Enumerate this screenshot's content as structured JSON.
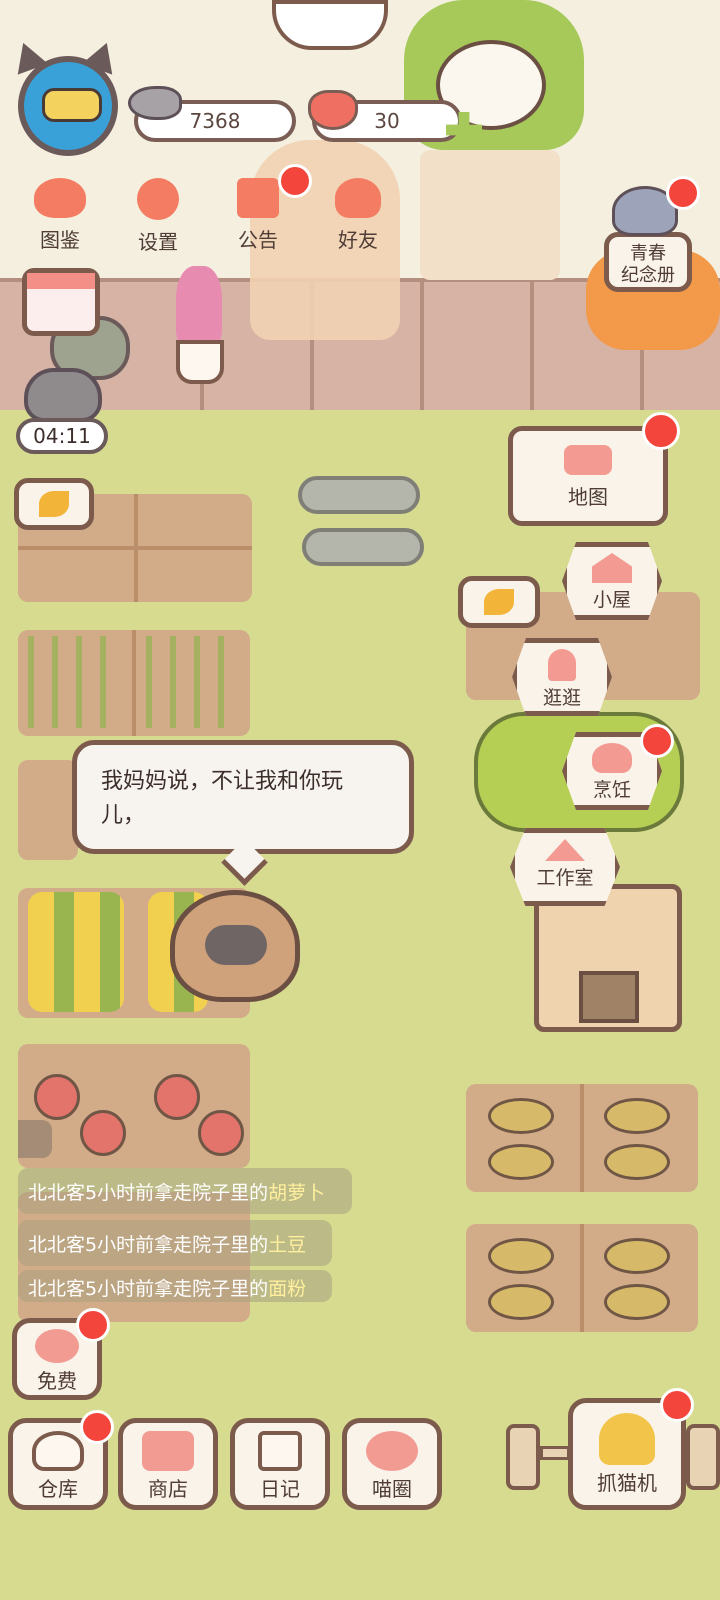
{
  "hud": {
    "fish_count": "7368",
    "heart_count": "30",
    "timer": "04:11"
  },
  "top_menu": [
    {
      "label": "图鉴",
      "icon": "cat-head-icon"
    },
    {
      "label": "设置",
      "icon": "gear-icon"
    },
    {
      "label": "公告",
      "icon": "gift-icon"
    },
    {
      "label": "好友",
      "icon": "friends-icon"
    }
  ],
  "album": {
    "line1": "青春",
    "line2": "纪念册"
  },
  "side_menu": {
    "map": "地图",
    "house": "小屋",
    "stroll": "逛逛",
    "cook": "烹饪",
    "workshop": "工作室"
  },
  "dialog": {
    "text": "我妈妈说，不让我和你玩儿，"
  },
  "feed": [
    {
      "prefix": "北北客5小时前拿走院子里的",
      "item": "胡萝卜"
    },
    {
      "prefix": "北北客5小时前拿走院子里的",
      "item": "土豆"
    },
    {
      "prefix": "北北客5小时前拿走院子里的",
      "item": "面粉"
    }
  ],
  "free": {
    "label": "免费"
  },
  "bottom_nav": [
    {
      "label": "仓库",
      "icon": "warehouse-icon"
    },
    {
      "label": "商店",
      "icon": "shop-icon"
    },
    {
      "label": "日记",
      "icon": "diary-icon"
    },
    {
      "label": "喵圈",
      "icon": "planet-cat-icon"
    }
  ],
  "claw": {
    "label": "抓猫机"
  },
  "colors": {
    "lawn": "#d6db90",
    "accent": "#f37c62",
    "badge": "#f4453d",
    "border": "#7d5b4c"
  }
}
